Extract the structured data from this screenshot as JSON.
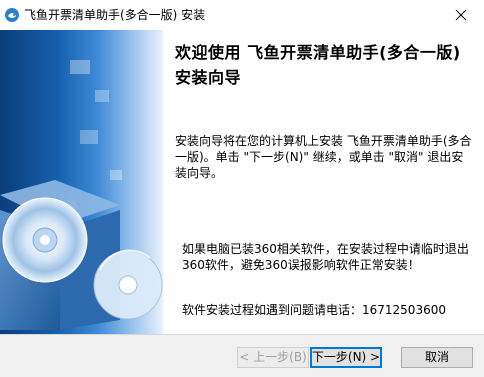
{
  "window": {
    "title": "飞鱼开票清单助手(多合一版) 安装"
  },
  "content": {
    "heading": "欢迎使用 飞鱼开票清单助手(多合一版) 安装向导",
    "intro": "安装向导将在您的计算机上安装 飞鱼开票清单助手(多合一版)。单击 \"下一步(N)\" 继续，或单击 \"取消\" 退出安装向导。",
    "notice": "如果电脑已装360相关软件，在安装过程中请临时退出360软件，避免360误报影响软件正常安装！",
    "contact": "软件安装过程如遇到问题请电话：16712503600"
  },
  "buttons": {
    "back": "< 上一步(B)",
    "next": "下一步(N) >",
    "cancel": "取消"
  },
  "icons": {
    "app": "app-icon",
    "close": "close-icon",
    "banner_art": "installer-box-cd-illustration"
  },
  "colors": {
    "accent": "#0078d7",
    "banner_dark": "#0a3d7a",
    "banner_light": "#a9cdf0"
  }
}
